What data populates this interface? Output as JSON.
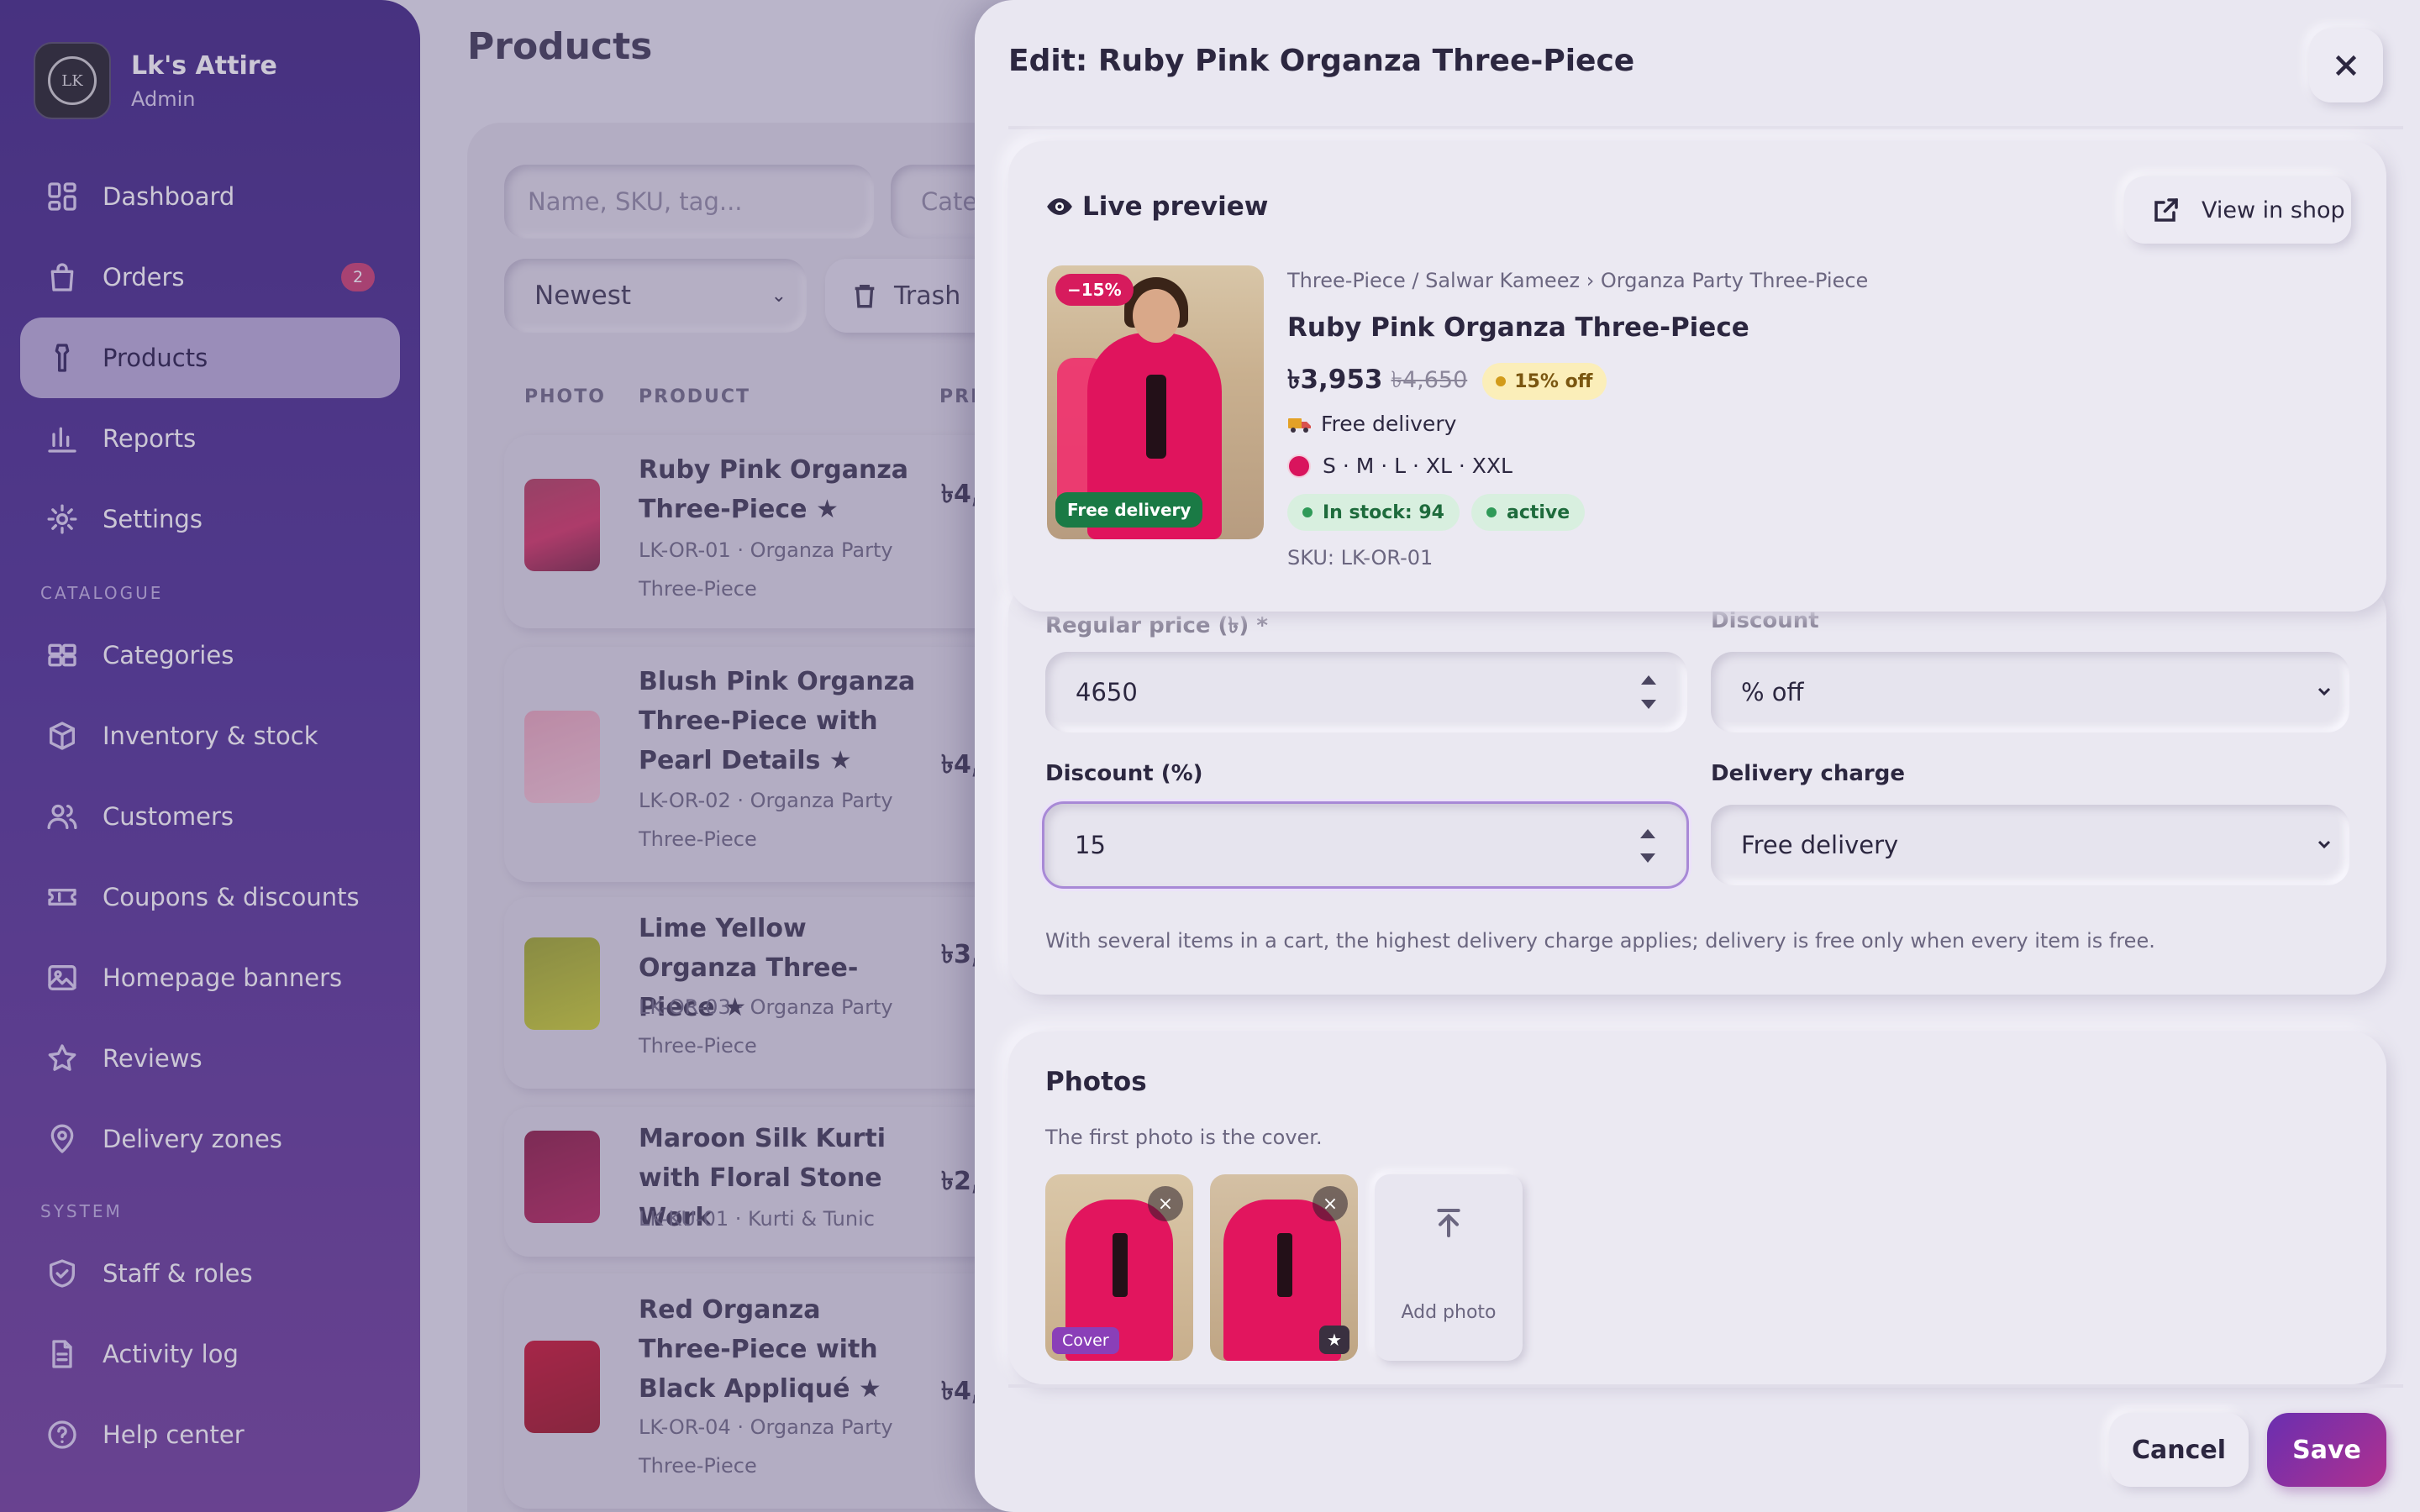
{
  "brand": {
    "name": "Lk's Attire",
    "role": "Admin",
    "logo_text": "LK"
  },
  "sidebar": {
    "items": [
      {
        "label": "Dashboard",
        "icon": "dashboard-icon"
      },
      {
        "label": "Orders",
        "icon": "bag-icon",
        "badge": "2"
      },
      {
        "label": "Products",
        "icon": "shirt-icon",
        "active": true
      },
      {
        "label": "Reports",
        "icon": "bar-chart-icon"
      },
      {
        "label": "Settings",
        "icon": "gear-icon"
      }
    ],
    "catalogue_label": "CATALOGUE",
    "catalogue": [
      {
        "label": "Categories",
        "icon": "grid-icon"
      },
      {
        "label": "Inventory & stock",
        "icon": "box-icon"
      },
      {
        "label": "Customers",
        "icon": "users-icon"
      },
      {
        "label": "Coupons & discounts",
        "icon": "ticket-icon"
      },
      {
        "label": "Homepage banners",
        "icon": "image-icon"
      },
      {
        "label": "Reviews",
        "icon": "star-icon"
      },
      {
        "label": "Delivery zones",
        "icon": "map-pin-icon"
      }
    ],
    "system_label": "SYSTEM",
    "system": [
      {
        "label": "Staff & roles",
        "icon": "shield-check-icon"
      },
      {
        "label": "Activity log",
        "icon": "document-icon"
      },
      {
        "label": "Help center",
        "icon": "help-circle-icon"
      }
    ]
  },
  "products_page": {
    "title": "Products",
    "search_placeholder": "Name, SKU, tag...",
    "category_filter": "Cate",
    "sort_value": "Newest",
    "trash_label": "Trash",
    "columns": [
      "PHOTO",
      "PRODUCT",
      "PRI"
    ],
    "rows": [
      {
        "name": "Ruby Pink Organza Three-Piece ★",
        "meta": "LK-OR-01 · Organza Party Three-Piece",
        "price": "৳4,"
      },
      {
        "name": "Blush Pink Organza Three-Piece with Pearl Details ★",
        "meta": "LK-OR-02 · Organza Party Three-Piece",
        "price": "৳4,"
      },
      {
        "name": "Lime Yellow Organza Three-Piece ★",
        "meta": "LK-OR-03 · Organza Party Three-Piece",
        "price": "৳3,"
      },
      {
        "name": "Maroon Silk Kurti with Floral Stone Work",
        "meta": "LK-KU-01 · Kurti & Tunic",
        "price": "৳2,"
      },
      {
        "name": "Red Organza Three-Piece with Black Appliqué ★",
        "meta": "LK-OR-04 · Organza Party Three-Piece",
        "price": "৳4,"
      }
    ]
  },
  "drawer": {
    "title": "Edit: Ruby Pink Organza Three-Piece",
    "preview": {
      "title": "Live preview",
      "view_in_shop": "View in shop",
      "discount_badge": "−15%",
      "delivery_badge": "Free delivery",
      "breadcrumb": "Three-Piece / Salwar Kameez › Organza Party Three-Piece",
      "name": "Ruby Pink Organza Three-Piece",
      "price": "৳3,953",
      "old_price": "৳4,650",
      "off_label": "15% off",
      "delivery": "Free delivery",
      "sizes": "S · M · L · XL · XXL",
      "stock": "In stock: 94",
      "status": "active",
      "sku": "SKU: LK-OR-01"
    },
    "fields": {
      "regular_price_label": "Regular price (৳) *",
      "regular_price_value": "4650",
      "discount_label": "Discount",
      "discount_value": "% off",
      "discount_pct_label": "Discount (%)",
      "discount_pct_value": "15",
      "delivery_label": "Delivery charge",
      "delivery_value": "Free delivery",
      "help": "With several items in a cart, the highest delivery charge applies; delivery is free only when every item is free."
    },
    "photos": {
      "title": "Photos",
      "subtitle": "The first photo is the cover.",
      "cover_tag": "Cover",
      "remove_symbol": "×",
      "star_symbol": "★",
      "add_label": "Add photo"
    },
    "cancel": "Cancel",
    "save": "Save"
  },
  "colors": {
    "accent": "#6a2fb0",
    "sidebar_bg": "#4a2c92",
    "discount_badge": "#d71b5d",
    "delivery_badge": "#1a7a45",
    "product_color": "#d9145d"
  }
}
